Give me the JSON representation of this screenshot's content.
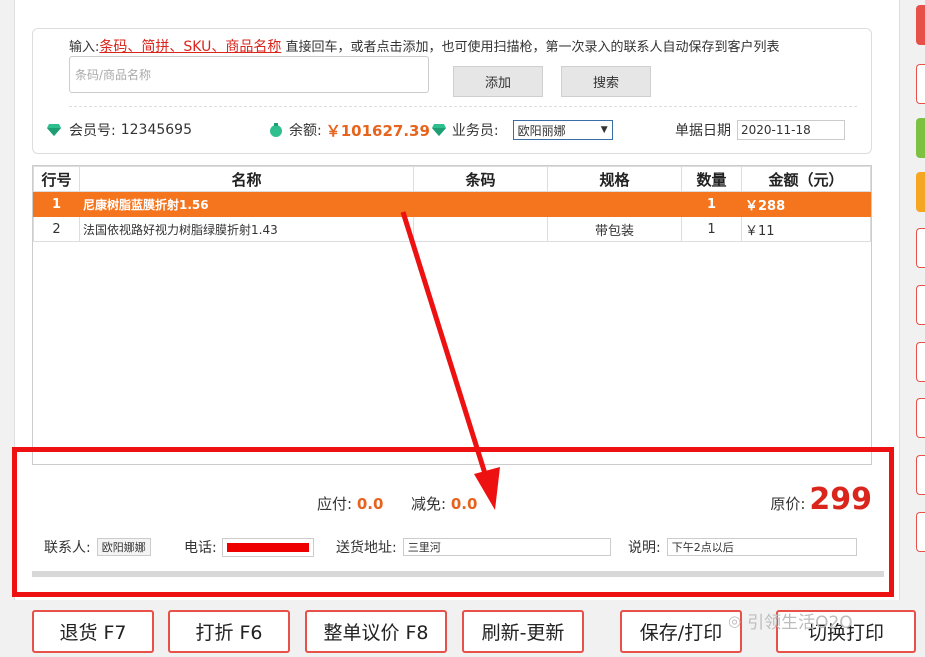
{
  "header": {
    "hint_prefix": "输入:",
    "hint_keys": "条码、简拼、SKU、商品名称",
    "hint_suffix": "直接回车，或者点击添加，也可使用扫描枪，第一次录入的联系人自动保存到客户列表",
    "search_placeholder": "条码/商品名称",
    "add_label": "添加",
    "search_label": "搜索"
  },
  "member": {
    "id_label": "会员号:",
    "id_value": "12345695",
    "balance_label": "余额:",
    "balance_value": "￥101627.39",
    "salesperson_label": "业务员:",
    "salesperson_value": "欧阳丽娜",
    "date_label": "单据日期",
    "date_value": "2020-11-18"
  },
  "table": {
    "headers": [
      "行号",
      "名称",
      "条码",
      "规格",
      "数量",
      "金额（元）"
    ],
    "rows": [
      {
        "no": "1",
        "name": "尼康树脂蓝膜折射1.56",
        "barcode": "",
        "spec": "",
        "qty": "1",
        "amount": "￥288"
      },
      {
        "no": "2",
        "name": "法国依视路好视力树脂绿膜折射1.43",
        "barcode": "",
        "spec": "带包装",
        "qty": "1",
        "amount": "￥11"
      }
    ]
  },
  "summary": {
    "payable_label": "应付:",
    "payable_value": "0.0",
    "discount_label": "减免:",
    "discount_value": "0.0",
    "original_label": "原价:",
    "original_value": "299",
    "contact_label": "联系人:",
    "contact_value": "欧阳娜娜",
    "phone_label": "电话:",
    "address_label": "送货地址:",
    "address_value": "三里河",
    "note_label": "说明:",
    "note_value": "下午2点以后"
  },
  "buttons": {
    "return": "退货 F7",
    "discount": "打折 F6",
    "bargain": "整单议价 F8",
    "refresh": "刷新-更新",
    "save_print": "保存/打印",
    "switch_print": "切换打印"
  },
  "watermark": "引领生活O2O",
  "colors": {
    "accent": "#f5751f",
    "highlight_red": "#e11111",
    "money": "#e6641e"
  }
}
